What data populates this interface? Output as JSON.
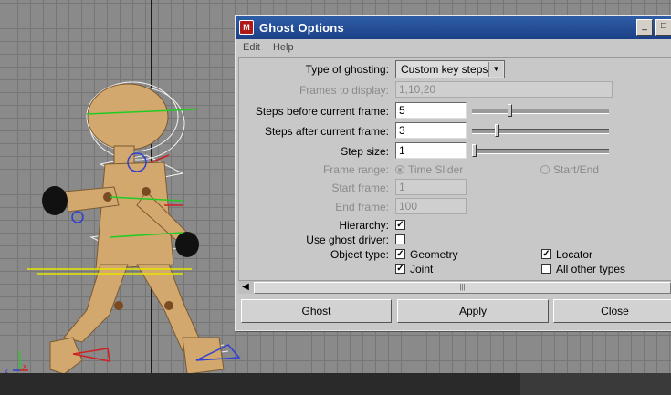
{
  "window": {
    "title": "Ghost Options",
    "minimize_glyph": "_",
    "maximize_glyph": "□"
  },
  "menu": [
    "Edit",
    "Help"
  ],
  "form": {
    "type_of_ghosting": {
      "label": "Type of ghosting:",
      "value": "Custom key steps"
    },
    "frames_to_display": {
      "label": "Frames to display:",
      "value": "1,10,20"
    },
    "steps_before": {
      "label": "Steps before current frame:",
      "value": "5",
      "slider_fraction": 0.27
    },
    "steps_after": {
      "label": "Steps after current frame:",
      "value": "3",
      "slider_fraction": 0.17
    },
    "step_size": {
      "label": "Step size:",
      "value": "1",
      "slider_fraction": 0.0
    },
    "frame_range": {
      "label": "Frame range:",
      "options": [
        "Time Slider",
        "Start/End"
      ],
      "selected": "Time Slider"
    },
    "start_frame": {
      "label": "Start frame:",
      "value": "1"
    },
    "end_frame": {
      "label": "End frame:",
      "value": "100"
    },
    "hierarchy": {
      "label": "Hierarchy:",
      "checked": true
    },
    "use_ghost_driver": {
      "label": "Use ghost driver:",
      "checked": false
    },
    "object_type": {
      "label": "Object type:",
      "options": [
        {
          "label": "Geometry",
          "checked": true
        },
        {
          "label": "Locator",
          "checked": true
        },
        {
          "label": "Joint",
          "checked": true
        },
        {
          "label": "All other types",
          "checked": false
        }
      ]
    }
  },
  "buttons": {
    "ghost": "Ghost",
    "apply": "Apply",
    "close": "Close"
  },
  "viewport": {
    "axis_labels": [
      "y",
      "z",
      "x"
    ]
  },
  "colors": {
    "titlebar": "#1b3f86",
    "window_bg": "#c8c8c8",
    "viewport_bg": "#8a8a8a"
  }
}
